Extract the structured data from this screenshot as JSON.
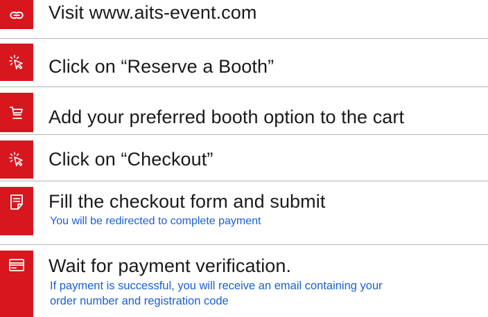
{
  "theme": {
    "badge_color": "#d8161e",
    "title_color": "#1a1a1a",
    "note_color": "#1a5fd0"
  },
  "steps": [
    {
      "icon": "link-icon",
      "title": "Visit www.aits-event.com"
    },
    {
      "icon": "cursor-click-icon",
      "title": "Click on “Reserve a Booth”"
    },
    {
      "icon": "cart-icon",
      "title": "Add your preferred booth option to the cart"
    },
    {
      "icon": "cursor-click-icon",
      "title": "Click on “Checkout”"
    },
    {
      "icon": "form-icon",
      "title": "Fill the checkout form and submit",
      "note": "You will be redirected to complete payment"
    },
    {
      "icon": "payment-card-icon",
      "title": "Wait for payment verification.",
      "note_line1": "If payment is successful, you will receive an email containing your",
      "note_line2": "order number and registration code"
    }
  ]
}
